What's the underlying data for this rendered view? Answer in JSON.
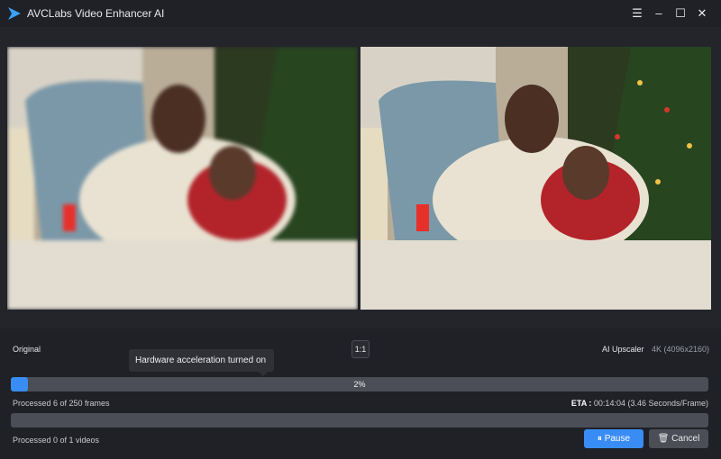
{
  "window": {
    "title": "AVCLabs Video Enhancer AI",
    "menu_icon": "☰",
    "minimize_icon": "–",
    "maximize_icon": "☐",
    "close_icon": "✕"
  },
  "preview": {
    "left_label": "Original",
    "ratio_label": "1:1",
    "right_label": "AI Upscaler",
    "resolution": "4K (4096x2160)"
  },
  "tooltip": "Hardware acceleration turned on",
  "progress": {
    "frame_percent_label": "2%",
    "frame_fraction": 0.024,
    "frames_text": "Processed 6 of 250 frames",
    "eta_label": "ETA : ",
    "eta_value": "00:14:04 (3.46 Seconds/Frame)",
    "video_fraction": 0,
    "videos_text": "Processed 0 of 1 videos"
  },
  "buttons": {
    "pause": "Pause",
    "pause_icon": "⏸",
    "cancel": "Cancel",
    "cancel_icon": "🗑"
  },
  "colors": {
    "accent": "#3a8cf5",
    "background": "#1f2126"
  }
}
